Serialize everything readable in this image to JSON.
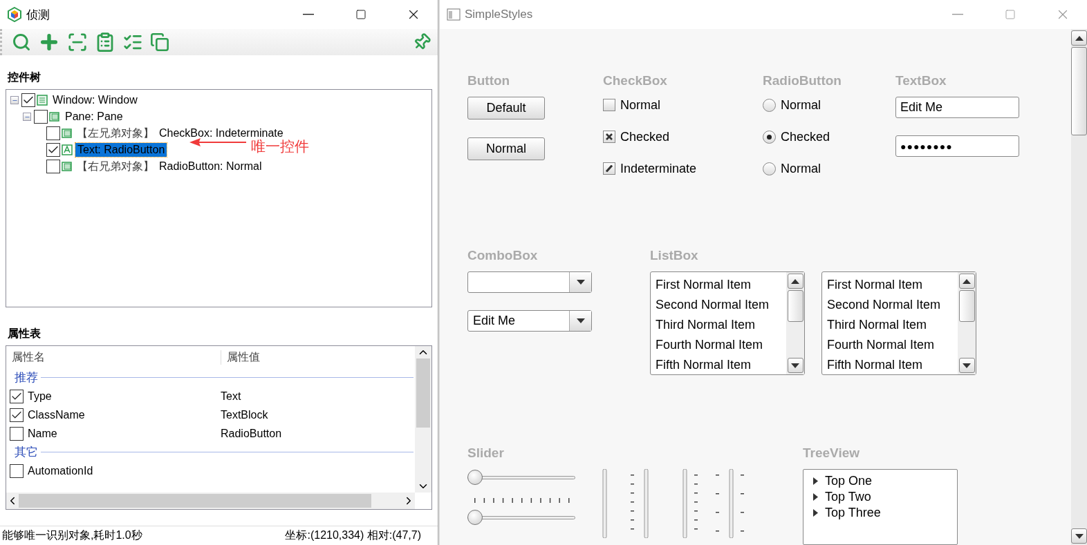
{
  "inspector": {
    "title": "侦测",
    "tree_heading": "控件树",
    "tree": [
      {
        "label": "Window: Window",
        "checked": true,
        "expanded": true,
        "selected": false,
        "kind": "window",
        "children": [
          {
            "label": "Pane: Pane",
            "checked": false,
            "expanded": true,
            "selected": false,
            "kind": "pane",
            "children": [
              {
                "prefix": "【左兄弟对象】",
                "label": "CheckBox: Indeterminate",
                "checked": false,
                "selected": false,
                "kind": "pane"
              },
              {
                "label": "Text: RadioButton",
                "checked": true,
                "selected": true,
                "kind": "text"
              },
              {
                "prefix": "【右兄弟对象】",
                "label": "RadioButton: Normal",
                "checked": false,
                "selected": false,
                "kind": "pane"
              }
            ]
          }
        ]
      }
    ],
    "annotation": "唯一控件",
    "props_heading": "属性表",
    "props_columns": [
      "属性名",
      "属性值"
    ],
    "groups": [
      {
        "name": "推荐",
        "rows": [
          {
            "name": "Type",
            "value": "Text",
            "checked": true
          },
          {
            "name": "ClassName",
            "value": "TextBlock",
            "checked": true
          },
          {
            "name": "Name",
            "value": "RadioButton",
            "checked": false
          }
        ]
      },
      {
        "name": "其它",
        "rows": [
          {
            "name": "AutomationId",
            "checked": false
          }
        ]
      }
    ],
    "status": {
      "message": "能够唯一识别对象,耗时1.0秒",
      "coords": "坐标:(1210,334) 相对:(47,7)"
    }
  },
  "demo": {
    "title": "SimpleStyles",
    "buttons": {
      "heading": "Button",
      "items": [
        {
          "label": "Default"
        },
        {
          "label": "Normal"
        }
      ]
    },
    "checkboxes": {
      "heading": "CheckBox",
      "items": [
        {
          "label": "Normal",
          "checked": false,
          "indeterminate": false
        },
        {
          "label": "Checked",
          "checked": true,
          "indeterminate": false
        },
        {
          "label": "Indeterminate",
          "checked": false,
          "indeterminate": true
        }
      ]
    },
    "radios": {
      "heading": "RadioButton",
      "items": [
        {
          "label": "Normal",
          "selected": false
        },
        {
          "label": "Checked",
          "selected": true
        },
        {
          "label": "Normal",
          "selected": false
        }
      ]
    },
    "textboxes": {
      "heading": "TextBox",
      "items": [
        {
          "kind": "text",
          "value": "Edit Me"
        },
        {
          "kind": "password",
          "value": "●●●●●●●●"
        }
      ]
    },
    "comboboxes": {
      "heading": "ComboBox",
      "items": [
        {
          "kind": "empty"
        },
        {
          "kind": "filled",
          "value": "Edit Me"
        }
      ]
    },
    "listboxes": {
      "heading": "ListBox",
      "lists": [
        {
          "items": [
            "First Normal Item",
            "Second Normal Item",
            "Third Normal Item",
            "Fourth Normal Item",
            "Fifth Normal Item"
          ]
        },
        {
          "items": [
            "First Normal Item",
            "Second Normal Item",
            "Third Normal Item",
            "Fourth Normal Item",
            "Fifth Normal Item"
          ]
        }
      ]
    },
    "sliders": {
      "heading": "Slider",
      "items": [
        {
          "level": 0,
          "ticks": false
        },
        {
          "level": 0,
          "ticks": true
        }
      ]
    },
    "treeview": {
      "heading": "TreeView",
      "items": [
        {
          "label": "Top One",
          "expanded": false
        },
        {
          "label": "Top Two",
          "expanded": false
        },
        {
          "label": "Top Three",
          "expanded": false
        }
      ]
    }
  }
}
